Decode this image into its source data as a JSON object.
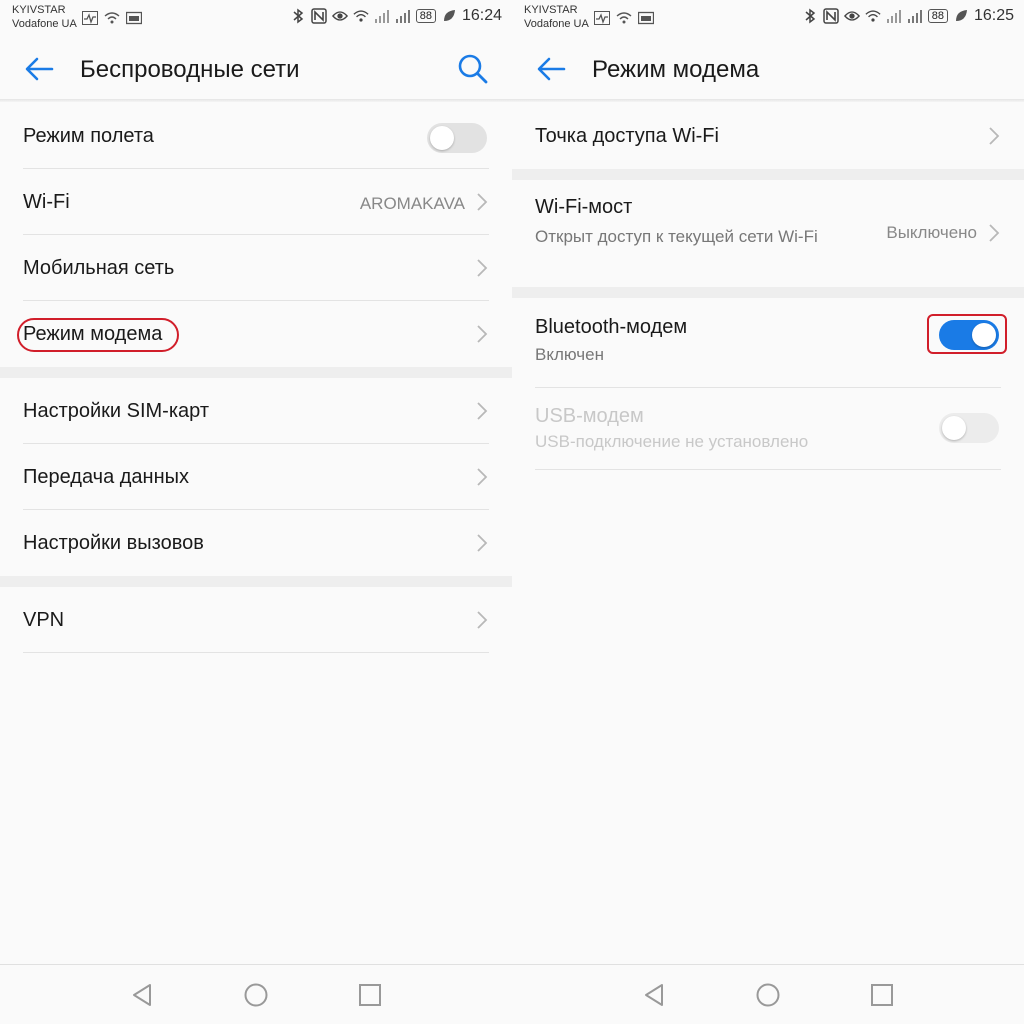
{
  "left": {
    "status": {
      "carrier1": "KYIVSTAR",
      "carrier2": "Vodafone UA",
      "battery": "88",
      "time": "16:24"
    },
    "header": {
      "title": "Беспроводные сети"
    },
    "items": {
      "airplane": {
        "label": "Режим полета",
        "toggle": "off"
      },
      "wifi": {
        "label": "Wi-Fi",
        "value": "AROMAKAVA"
      },
      "mobile": {
        "label": "Мобильная сеть"
      },
      "tethering": {
        "label": "Режим модема"
      },
      "sim": {
        "label": "Настройки SIM-карт"
      },
      "data": {
        "label": "Передача данных"
      },
      "calls": {
        "label": "Настройки вызовов"
      },
      "vpn": {
        "label": "VPN"
      }
    }
  },
  "right": {
    "status": {
      "carrier1": "KYIVSTAR",
      "carrier2": "Vodafone UA",
      "battery": "88",
      "time": "16:25"
    },
    "header": {
      "title": "Режим модема"
    },
    "items": {
      "hotspot": {
        "label": "Точка доступа Wi-Fi"
      },
      "bridge": {
        "label": "Wi-Fi-мост",
        "sub": "Открыт доступ к текущей сети Wi-Fi",
        "value": "Выключено"
      },
      "bt": {
        "label": "Bluetooth-модем",
        "sub": "Включен",
        "toggle": "on"
      },
      "usb": {
        "label": "USB-модем",
        "sub": "USB-подключение не установлено",
        "toggle": "off"
      }
    }
  },
  "colors": {
    "accent": "#1a7be6",
    "highlight": "#d11e2a"
  },
  "icons": [
    "back-arrow-icon",
    "search-icon",
    "chevron-right-icon",
    "bluetooth-icon",
    "nfc-icon",
    "eye-icon",
    "wifi-icon",
    "signal-icon",
    "battery-icon",
    "leaf-icon",
    "nav-back-icon",
    "nav-home-icon",
    "nav-recents-icon"
  ]
}
